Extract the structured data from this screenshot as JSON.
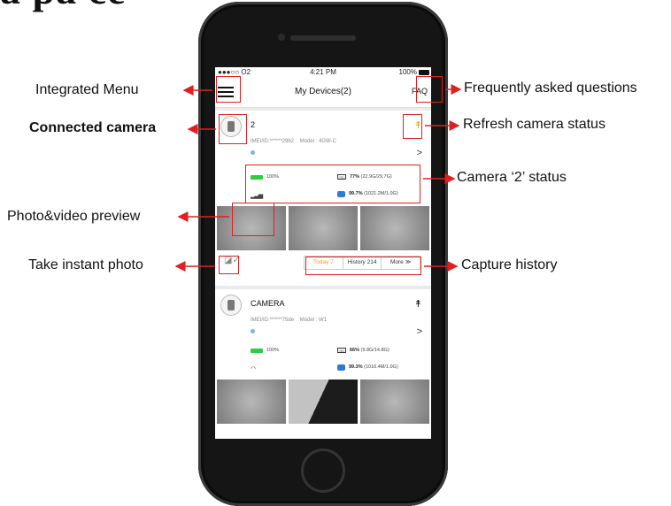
{
  "page_heading": "a   pa     ce",
  "status_bar": {
    "carrier": "●●●○○ O2",
    "time": "4:21 PM",
    "battery": "100%"
  },
  "navbar": {
    "title": "My Devices(2)",
    "faq": "FAQ"
  },
  "cameras": [
    {
      "name": "2",
      "imei": "IMEI/ID:******29b2",
      "model": "Model : 4GW-C",
      "battery": "100%",
      "sd_pct": "77%",
      "sd_detail": "(22.9G/29.7G)",
      "storage_pct": "99.7%",
      "storage_detail": "(1021.2M/1.0G)",
      "history": {
        "today": "Today 7",
        "history": "History 214",
        "more": "More ≫"
      }
    },
    {
      "name": "CAMERA",
      "imei": "IMEI/ID:******75de",
      "model": "Model : W1",
      "battery": "100%",
      "sd_pct": "66%",
      "sd_detail": "(9.8G/14.8G)",
      "storage_pct": "99.3%",
      "storage_detail": "(1016.4M/1.0G)"
    }
  ],
  "annotations": {
    "integrated_menu": "Integrated Menu",
    "connected_camera": "Connected camera",
    "photo_video_preview": "Photo&video preview",
    "take_instant_photo": "Take instant photo",
    "faq_desc": "Frequently asked questions",
    "refresh_status": "Refresh camera status",
    "camera_status": "Camera ‘2’ status",
    "capture_history": "Capture history"
  },
  "colors": {
    "annotation_red": "#e02020",
    "accent_orange": "#f39c12",
    "battery_green": "#2ecc40",
    "storage_blue": "#2b7bd6"
  }
}
